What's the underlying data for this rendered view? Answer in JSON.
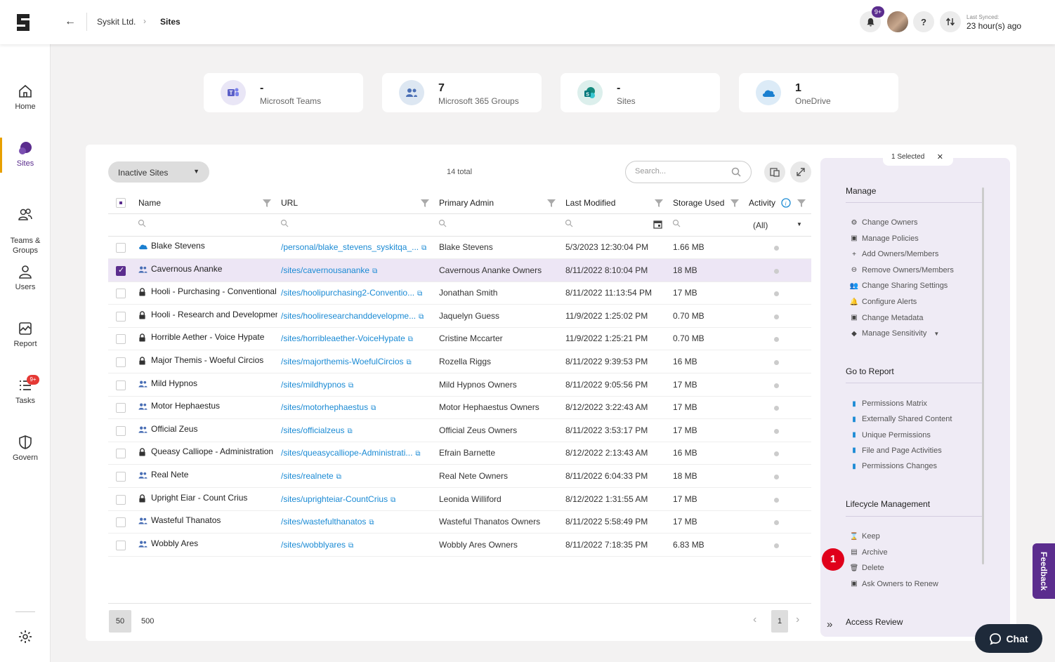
{
  "topbar": {
    "breadcrumb_org": "Syskit Ltd.",
    "breadcrumb_sep": "›",
    "breadcrumb_current": "Sites",
    "notif_badge": "9+",
    "help": "?",
    "last_synced_label": "Last Synced:",
    "last_synced_value": "23 hour(s) ago"
  },
  "sidebar": {
    "items": [
      {
        "label": "Home",
        "icon": "home-icon"
      },
      {
        "label": "Sites",
        "icon": "sites-icon"
      },
      {
        "label": "Teams &\nGroups",
        "icon": "teams-groups-icon"
      },
      {
        "label": "Users",
        "icon": "users-icon"
      },
      {
        "label": "Report",
        "icon": "report-icon"
      },
      {
        "label": "Tasks",
        "icon": "tasks-icon",
        "badge": "9+"
      },
      {
        "label": "Govern",
        "icon": "govern-icon"
      }
    ]
  },
  "stats": [
    {
      "value": "-",
      "label": "Microsoft Teams",
      "color": "#5b5fc7",
      "bg": "#e9e6f6"
    },
    {
      "value": "7",
      "label": "Microsoft 365 Groups",
      "color": "#4a6fb5",
      "bg": "#dde7f2"
    },
    {
      "value": "-",
      "label": "Sites",
      "color": "#138a7c",
      "bg": "#dcefec"
    },
    {
      "value": "1",
      "label": "OneDrive",
      "color": "#1a7fd0",
      "bg": "#dcebf7"
    }
  ],
  "toolbar": {
    "filter_label": "Inactive Sites",
    "total": "14 total",
    "search_placeholder": "Search..."
  },
  "table": {
    "columns": [
      "Name",
      "URL",
      "Primary Admin",
      "Last Modified",
      "Storage Used",
      "Activity"
    ],
    "activity_filter": "(All)",
    "rows": [
      {
        "type": "onedrive",
        "name": "Blake Stevens",
        "url": "/personal/blake_stevens_syskitqa_...",
        "admin": "Blake Stevens",
        "modified": "5/3/2023 12:30:04 PM",
        "size": "1.66 MB",
        "selected": false
      },
      {
        "type": "group",
        "name": "Cavernous Ananke",
        "url": "/sites/cavernousananke",
        "admin": "Cavernous Ananke Owners",
        "modified": "8/11/2022 8:10:04 PM",
        "size": "18 MB",
        "selected": true
      },
      {
        "type": "lock",
        "name": "Hooli - Purchasing - Conventional",
        "url": "/sites/hoolipurchasing2-Conventio...",
        "admin": "Jonathan Smith",
        "modified": "8/11/2022 11:13:54 PM",
        "size": "17 MB",
        "selected": false
      },
      {
        "type": "lock",
        "name": "Hooli - Research and Development",
        "url": "/sites/hooliresearchanddevelopme...",
        "admin": "Jaquelyn Guess",
        "modified": "11/9/2022 1:25:02 PM",
        "size": "0.70 MB",
        "selected": false
      },
      {
        "type": "lock",
        "name": "Horrible Aether - Voice Hypate",
        "url": "/sites/horribleaether-VoiceHypate",
        "admin": "Cristine Mccarter",
        "modified": "11/9/2022 1:25:21 PM",
        "size": "0.70 MB",
        "selected": false
      },
      {
        "type": "lock",
        "name": "Major Themis - Woeful Circios",
        "url": "/sites/majorthemis-WoefulCircios",
        "admin": "Rozella Riggs",
        "modified": "8/11/2022 9:39:53 PM",
        "size": "16 MB",
        "selected": false
      },
      {
        "type": "group",
        "name": "Mild Hypnos",
        "url": "/sites/mildhypnos",
        "admin": "Mild Hypnos Owners",
        "modified": "8/11/2022 9:05:56 PM",
        "size": "17 MB",
        "selected": false
      },
      {
        "type": "group",
        "name": "Motor Hephaestus",
        "url": "/sites/motorhephaestus",
        "admin": "Motor Hephaestus Owners",
        "modified": "8/12/2022 3:22:43 AM",
        "size": "17 MB",
        "selected": false
      },
      {
        "type": "group",
        "name": "Official Zeus",
        "url": "/sites/officialzeus",
        "admin": "Official Zeus Owners",
        "modified": "8/11/2022 3:53:17 PM",
        "size": "17 MB",
        "selected": false
      },
      {
        "type": "lock",
        "name": "Queasy Calliope - Administration",
        "url": "/sites/queasycalliope-Administrati...",
        "admin": "Efrain Barnette",
        "modified": "8/12/2022 2:13:43 AM",
        "size": "16 MB",
        "selected": false
      },
      {
        "type": "group",
        "name": "Real Nete",
        "url": "/sites/realnete",
        "admin": "Real Nete Owners",
        "modified": "8/11/2022 6:04:33 PM",
        "size": "18 MB",
        "selected": false
      },
      {
        "type": "lock",
        "name": "Upright Eiar - Count Crius",
        "url": "/sites/uprighteiar-CountCrius",
        "admin": "Leonida Williford",
        "modified": "8/12/2022 1:31:55 AM",
        "size": "17 MB",
        "selected": false
      },
      {
        "type": "group",
        "name": "Wasteful Thanatos",
        "url": "/sites/wastefulthanatos",
        "admin": "Wasteful Thanatos Owners",
        "modified": "8/11/2022 5:58:49 PM",
        "size": "17 MB",
        "selected": false
      },
      {
        "type": "group",
        "name": "Wobbly Ares",
        "url": "/sites/wobblyares",
        "admin": "Wobbly Ares Owners",
        "modified": "8/11/2022 7:18:35 PM",
        "size": "6.83 MB",
        "selected": false
      }
    ]
  },
  "pagination": {
    "size_current": "50",
    "size_alt": "500",
    "page": "1"
  },
  "right_panel": {
    "selected_label": "1 Selected",
    "manage_title": "Manage",
    "manage_actions": [
      "Change Owners",
      "Manage Policies",
      "Add Owners/Members",
      "Remove Owners/Members",
      "Change Sharing Settings",
      "Configure Alerts",
      "Change Metadata",
      "Manage Sensitivity"
    ],
    "report_title": "Go to Report",
    "report_actions": [
      "Permissions Matrix",
      "Externally Shared Content",
      "Unique Permissions",
      "File and Page Activities",
      "Permissions Changes"
    ],
    "lifecycle_title": "Lifecycle Management",
    "lifecycle_actions": [
      "Keep",
      "Archive",
      "Delete",
      "Ask Owners to Renew"
    ],
    "access_review_title": "Access Review",
    "step_badge": "1"
  },
  "feedback_label": "Feedback",
  "chat_label": "Chat",
  "colors": {
    "accent": "#5b2d8e",
    "link": "#1a8ad4",
    "active_bar": "#e8a000",
    "badge": "#e53935"
  }
}
